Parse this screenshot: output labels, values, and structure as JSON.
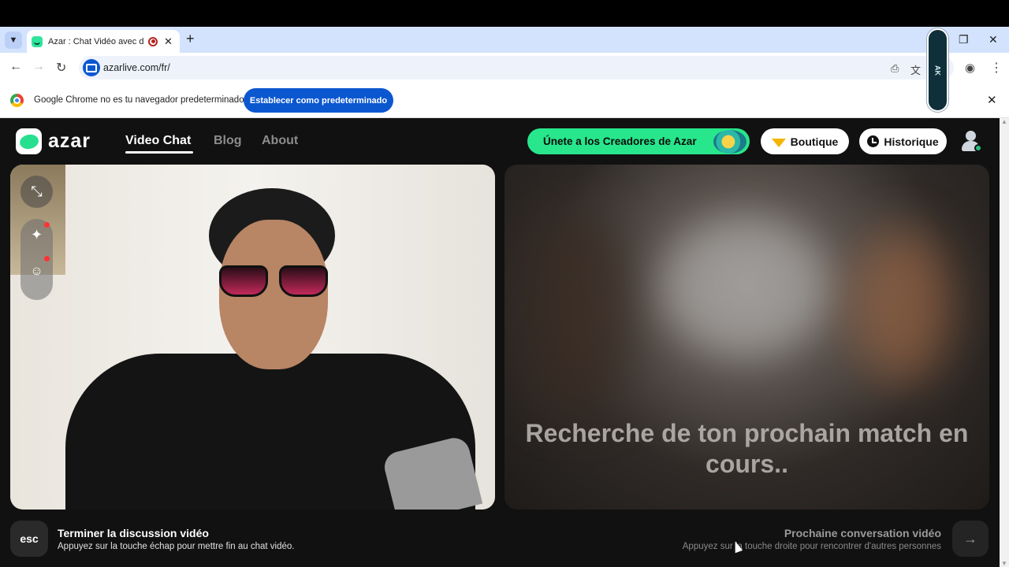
{
  "browser": {
    "tab_title": "Azar : Chat Vidéo avec de n",
    "tab_list_icon": "chevron-down-icon",
    "new_tab": "+",
    "tab_close": "✕",
    "url": "azarlive.com/fr/",
    "win_restore": "❐",
    "win_close": "✕",
    "back": "←",
    "forward": "→",
    "reload": "↻",
    "menu": "⋮"
  },
  "infobar": {
    "message": "Google Chrome no es tu navegador predeterminado",
    "button": "Establecer como predeterminado",
    "close": "✕"
  },
  "badge": "AK",
  "site": {
    "logo": "azar",
    "nav": [
      "Video Chat",
      "Blog",
      "About"
    ],
    "creators": "Únete a los Creadores de Azar",
    "boutique": "Boutique",
    "historique": "Historique",
    "searching": "Recherche de ton prochain match en cours..",
    "esc": "esc",
    "end_title": "Terminer la discussion vidéo",
    "end_sub": "Appuyez sur la touche échap pour mettre fin au chat vidéo.",
    "next_title": "Prochaine conversation vidéo",
    "next_sub": "Appuyez sur la touche droite pour rencontrer d'autres personnes",
    "next_arrow": "→"
  },
  "colors": {
    "brand_green": "#27e68b",
    "chrome_blue": "#0b57d0",
    "background": "#111111"
  }
}
